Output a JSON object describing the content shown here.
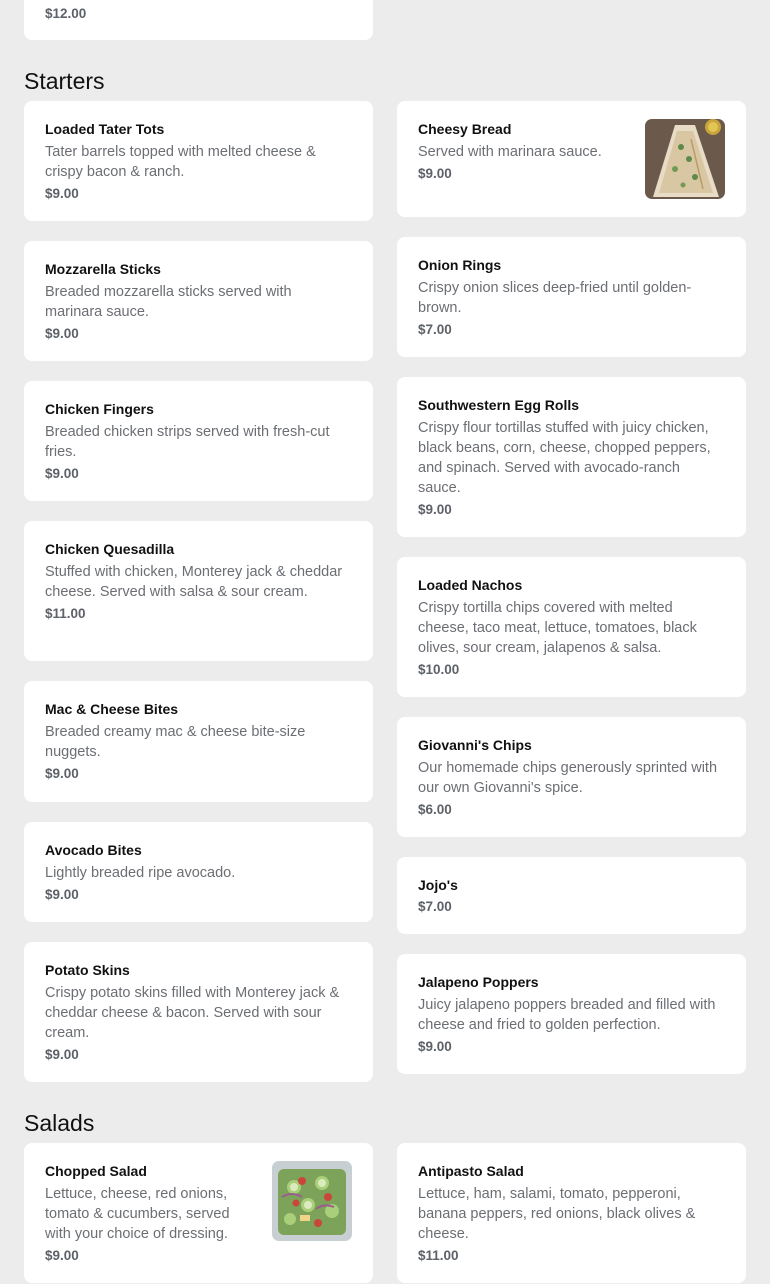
{
  "top_item": {
    "price": "$12.00"
  },
  "sections": {
    "starters": {
      "title": "Starters"
    },
    "salads": {
      "title": "Salads"
    }
  },
  "starters_left": [
    {
      "name": "Loaded Tater Tots",
      "desc": "Tater barrels topped with melted cheese & crispy bacon & ranch.",
      "price": "$9.00"
    },
    {
      "name": "Mozzarella Sticks",
      "desc": "Breaded mozzarella sticks served with marinara sauce.",
      "price": "$9.00"
    },
    {
      "name": "Chicken Fingers",
      "desc": "Breaded chicken strips served with fresh-cut fries.",
      "price": "$9.00"
    },
    {
      "name": "Chicken Quesadilla",
      "desc": "Stuffed with chicken, Monterey jack & cheddar cheese. Served with salsa & sour cream.",
      "price": "$11.00"
    },
    {
      "name": "Mac & Cheese Bites",
      "desc": "Breaded creamy mac & cheese bite-size nuggets.",
      "price": "$9.00"
    },
    {
      "name": "Avocado Bites",
      "desc": "Lightly breaded ripe avocado.",
      "price": "$9.00"
    },
    {
      "name": "Potato Skins",
      "desc": "Crispy potato skins filled with Monterey jack & cheddar cheese & bacon. Served with sour cream.",
      "price": "$9.00"
    }
  ],
  "starters_right": [
    {
      "name": "Cheesy Bread",
      "desc": "Served with marinara sauce.",
      "price": "$9.00",
      "image": "cheesy-bread-photo"
    },
    {
      "name": "Onion Rings",
      "desc": "Crispy onion slices deep-fried until golden-brown.",
      "price": "$7.00"
    },
    {
      "name": "Southwestern Egg Rolls",
      "desc": "Crispy flour tortillas stuffed with juicy chicken, black beans, corn, cheese, chopped peppers, and spinach. Served with avocado-ranch sauce.",
      "price": "$9.00"
    },
    {
      "name": "Loaded Nachos",
      "desc": "Crispy tortilla chips covered with melted cheese, taco meat, lettuce, tomatoes, black olives, sour cream, jalapenos & salsa.",
      "price": "$10.00"
    },
    {
      "name": "Giovanni's Chips",
      "desc": "Our homemade chips generously sprinted with our own Giovanni's spice.",
      "price": "$6.00"
    },
    {
      "name": "Jojo's",
      "desc": "",
      "price": "$7.00"
    },
    {
      "name": "Jalapeno Poppers",
      "desc": "Juicy jalapeno poppers breaded and filled with cheese and fried to golden perfection.",
      "price": "$9.00"
    }
  ],
  "salads_left": [
    {
      "name": "Chopped Salad",
      "desc": "Lettuce, cheese, red onions, tomato & cucumbers, served with your choice of dressing.",
      "price": "$9.00",
      "image": "chopped-salad-photo"
    }
  ],
  "salads_right": [
    {
      "name": "Antipasto Salad",
      "desc": "Lettuce, ham, salami, tomato, pepperoni, banana peppers, red onions, black olives & cheese.",
      "price": "$11.00"
    }
  ]
}
